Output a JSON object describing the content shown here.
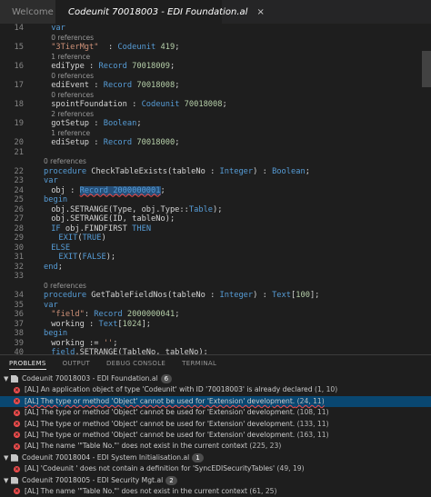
{
  "tabs": [
    {
      "label": "Welcome",
      "active": false
    },
    {
      "label": "Codeunit 70018003 - EDI Foundation.al",
      "active": true,
      "close": "×"
    }
  ],
  "editor": {
    "lines": [
      {
        "kind": "code",
        "num": "14",
        "tokens": [
          [
            "kw",
            "var"
          ]
        ]
      },
      {
        "kind": "lens",
        "text": "0 references"
      },
      {
        "kind": "code",
        "num": "15",
        "tokens": [
          [
            "str",
            "\"3TierMgt\""
          ],
          [
            "",
            "  : "
          ],
          [
            "kw",
            "Codeunit"
          ],
          [
            "",
            " "
          ],
          [
            "num",
            "419"
          ],
          [
            "",
            ";"
          ]
        ]
      },
      {
        "kind": "lens",
        "text": "1 reference"
      },
      {
        "kind": "code",
        "num": "16",
        "tokens": [
          [
            "",
            "ediType : "
          ],
          [
            "kw",
            "Record"
          ],
          [
            "",
            " "
          ],
          [
            "num",
            "70018009"
          ],
          [
            "",
            ";"
          ]
        ]
      },
      {
        "kind": "lens",
        "text": "0 references"
      },
      {
        "kind": "code",
        "num": "17",
        "tokens": [
          [
            "",
            "ediEvent : "
          ],
          [
            "kw",
            "Record"
          ],
          [
            "",
            " "
          ],
          [
            "num",
            "70018008"
          ],
          [
            "",
            ";"
          ]
        ]
      },
      {
        "kind": "lens",
        "text": "0 references"
      },
      {
        "kind": "code",
        "num": "18",
        "tokens": [
          [
            "",
            "spointFoundation : "
          ],
          [
            "kw",
            "Codeunit"
          ],
          [
            "",
            " "
          ],
          [
            "num",
            "70018008"
          ],
          [
            "",
            ";"
          ]
        ]
      },
      {
        "kind": "lens",
        "text": "2 references"
      },
      {
        "kind": "code",
        "num": "19",
        "tokens": [
          [
            "",
            "gotSetup : "
          ],
          [
            "kw",
            "Boolean"
          ],
          [
            "",
            ";"
          ]
        ]
      },
      {
        "kind": "lens",
        "text": "1 reference"
      },
      {
        "kind": "code",
        "num": "20",
        "tokens": [
          [
            "",
            "ediSetup : "
          ],
          [
            "kw",
            "Record"
          ],
          [
            "",
            " "
          ],
          [
            "num",
            "70018000"
          ],
          [
            "",
            ";"
          ]
        ]
      },
      {
        "kind": "code",
        "num": "21",
        "tokens": []
      },
      {
        "kind": "lens",
        "text": "0 references",
        "indent": 0
      },
      {
        "kind": "code",
        "num": "22",
        "indent": 0,
        "tokens": [
          [
            "kw",
            "procedure"
          ],
          [
            "",
            " CheckTableExists(tableNo : "
          ],
          [
            "kw",
            "Integer"
          ],
          [
            "",
            ") : "
          ],
          [
            "kw",
            "Boolean"
          ],
          [
            "",
            ";"
          ]
        ]
      },
      {
        "kind": "code",
        "num": "23",
        "indent": 0,
        "tokens": [
          [
            "kw",
            "var"
          ]
        ]
      },
      {
        "kind": "code",
        "num": "24",
        "tokens": [
          [
            "",
            "obj : "
          ],
          [
            "sel",
            "Record 2000000001"
          ],
          [
            "",
            ";"
          ]
        ]
      },
      {
        "kind": "code",
        "num": "25",
        "indent": 0,
        "tokens": [
          [
            "kw",
            "begin"
          ]
        ]
      },
      {
        "kind": "code",
        "num": "26",
        "tokens": [
          [
            "",
            "obj.SETRANGE(Type, obj.Type::"
          ],
          [
            "kw",
            "Table"
          ],
          [
            "",
            ");"
          ]
        ]
      },
      {
        "kind": "code",
        "num": "27",
        "tokens": [
          [
            "",
            "obj.SETRANGE(ID, tableNo);"
          ]
        ]
      },
      {
        "kind": "code",
        "num": "28",
        "tokens": [
          [
            "kw",
            "IF"
          ],
          [
            "",
            " obj.FINDFIRST "
          ],
          [
            "kw",
            "THEN"
          ]
        ]
      },
      {
        "kind": "code",
        "num": "29",
        "indent": 2,
        "tokens": [
          [
            "kw",
            "EXIT"
          ],
          [
            "",
            "("
          ],
          [
            "kw",
            "TRUE"
          ],
          [
            "",
            ")"
          ]
        ]
      },
      {
        "kind": "code",
        "num": "30",
        "tokens": [
          [
            "kw",
            "ELSE"
          ]
        ]
      },
      {
        "kind": "code",
        "num": "31",
        "indent": 2,
        "tokens": [
          [
            "kw",
            "EXIT"
          ],
          [
            "",
            "("
          ],
          [
            "kw",
            "FALSE"
          ],
          [
            "",
            ");"
          ]
        ]
      },
      {
        "kind": "code",
        "num": "32",
        "indent": 0,
        "tokens": [
          [
            "kw",
            "end"
          ],
          [
            "",
            ";"
          ]
        ]
      },
      {
        "kind": "code",
        "num": "33",
        "tokens": []
      },
      {
        "kind": "lens",
        "text": "0 references",
        "indent": 0
      },
      {
        "kind": "code",
        "num": "34",
        "indent": 0,
        "tokens": [
          [
            "kw",
            "procedure"
          ],
          [
            "",
            " GetTableFieldNos(tableNo : "
          ],
          [
            "kw",
            "Integer"
          ],
          [
            "",
            ") : "
          ],
          [
            "kw",
            "Text"
          ],
          [
            "",
            "["
          ],
          [
            "num",
            "100"
          ],
          [
            "",
            "];"
          ]
        ]
      },
      {
        "kind": "code",
        "num": "35",
        "indent": 0,
        "tokens": [
          [
            "kw",
            "var"
          ]
        ]
      },
      {
        "kind": "code",
        "num": "36",
        "tokens": [
          [
            "str",
            "\"field\""
          ],
          [
            "",
            ": "
          ],
          [
            "kw",
            "Record"
          ],
          [
            "",
            " "
          ],
          [
            "num",
            "2000000041"
          ],
          [
            "",
            ";"
          ]
        ]
      },
      {
        "kind": "code",
        "num": "37",
        "tokens": [
          [
            "",
            "working : "
          ],
          [
            "kw",
            "Text"
          ],
          [
            "",
            "["
          ],
          [
            "num",
            "1024"
          ],
          [
            "",
            "];"
          ]
        ]
      },
      {
        "kind": "code",
        "num": "38",
        "indent": 0,
        "tokens": [
          [
            "kw",
            "begin"
          ]
        ]
      },
      {
        "kind": "code",
        "num": "39",
        "tokens": [
          [
            "",
            "working := "
          ],
          [
            "str",
            "''"
          ],
          [
            "",
            ";"
          ]
        ]
      },
      {
        "kind": "code",
        "num": "40",
        "tokens": [
          [
            "kw",
            "field"
          ],
          [
            "",
            ".SETRANGE(TableNo, tableNo);"
          ]
        ]
      }
    ]
  },
  "panel": {
    "tabs": [
      "PROBLEMS",
      "OUTPUT",
      "DEBUG CONSOLE",
      "TERMINAL"
    ],
    "groups": [
      {
        "file": "Codeunit 70018003 - EDI Foundation.al",
        "count": "6",
        "items": [
          {
            "text": "[AL] An application object of type 'Codeunit' with ID '70018003' is already declared",
            "loc": "(1, 10)",
            "selected": false
          },
          {
            "text": "[AL] The type or method 'Object' cannot be used for 'Extension' development.",
            "loc": "(24, 11)",
            "selected": true
          },
          {
            "text": "[AL] The type or method 'Object' cannot be used for 'Extension' development.",
            "loc": "(108, 11)",
            "selected": false
          },
          {
            "text": "[AL] The type or method 'Object' cannot be used for 'Extension' development.",
            "loc": "(133, 11)",
            "selected": false
          },
          {
            "text": "[AL] The type or method 'Object' cannot be used for 'Extension' development.",
            "loc": "(163, 11)",
            "selected": false
          },
          {
            "text": "[AL] The name '\"Table No.\"' does not exist in the current context",
            "loc": "(225, 23)",
            "selected": false
          }
        ]
      },
      {
        "file": "Codeunit 70018004 - EDI System Initialisation.al",
        "count": "1",
        "items": [
          {
            "text": "[AL] 'Codeunit ' does not contain a definition for 'SyncEDISecurityTables'",
            "loc": "(49, 19)",
            "selected": false
          }
        ]
      },
      {
        "file": "Codeunit 70018005 - EDI Security Mgt.al",
        "count": "2",
        "items": [
          {
            "text": "[AL] The name '\"Table No.\"' does not exist in the current context",
            "loc": "(61, 25)",
            "selected": false
          }
        ]
      }
    ]
  },
  "colors": {
    "error": "#f14c4c",
    "keyword": "#569cd6",
    "string": "#ce9178",
    "number": "#b5cea8",
    "selection": "#094771"
  },
  "icons": [
    "file-icon",
    "close-icon",
    "error-icon",
    "chevron-down-icon"
  ]
}
